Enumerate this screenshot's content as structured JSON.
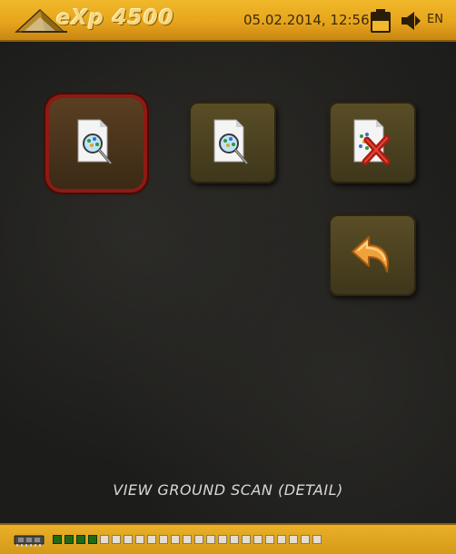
{
  "header": {
    "logo_text": "eXp 4500",
    "datetime": "05.02.2014, 12:56",
    "battery_icon": "battery-icon",
    "speaker_icon": "speaker-icon",
    "language": "EN"
  },
  "menu": {
    "buttons": [
      {
        "name": "view-scan-detail-button",
        "icon": "document-magnifier-icon",
        "selected": true
      },
      {
        "name": "view-scan-button",
        "icon": "document-magnifier-icon",
        "selected": false
      },
      {
        "name": "delete-scan-button",
        "icon": "document-delete-icon",
        "selected": false
      },
      {
        "name": "back-button",
        "icon": "back-arrow-icon",
        "selected": false
      }
    ],
    "caption": "VIEW GROUND SCAN (DETAIL)"
  },
  "footer": {
    "memory_icon": "memory-chip-icon",
    "segments_total": 23,
    "segments_filled": 4,
    "colors": {
      "filled": "#1f6a1a",
      "empty": "#e4ddd0"
    }
  },
  "colors": {
    "accent_gold": "#e7a51c",
    "selection_red": "#8d1a14",
    "background": "#1c1c1a"
  }
}
